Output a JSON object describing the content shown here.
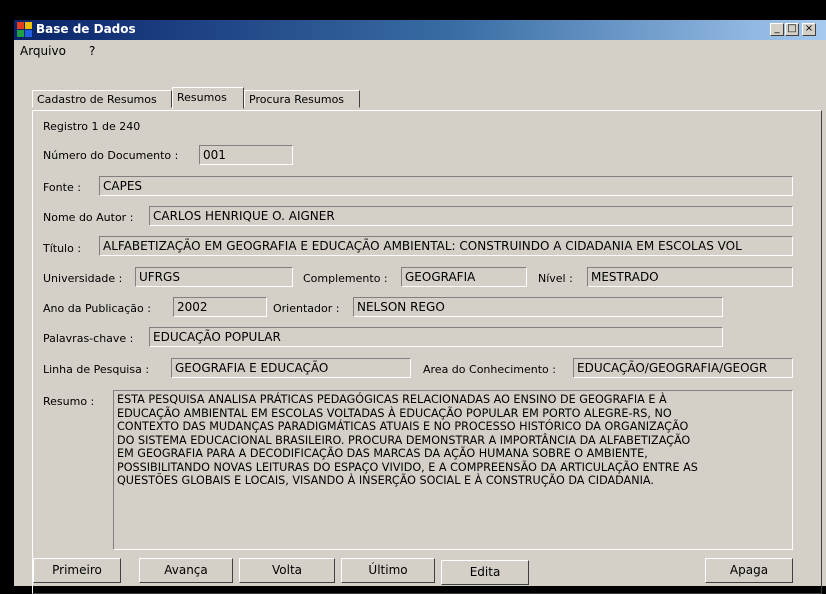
{
  "window": {
    "title": "Base de Dados",
    "minimize": "_",
    "maximize": "□",
    "close": "×"
  },
  "menu": [
    "Arquivo",
    "?"
  ],
  "tabs": [
    "Cadastro de Resumos",
    "Resumos",
    "Procura Resumos"
  ],
  "active_tab": "Resumos",
  "record_status": "Registro 1 de 240",
  "form": {
    "numero": {
      "label": "Número do Documento :",
      "value": "001"
    },
    "fonte": {
      "label": "Fonte :",
      "value": "CAPES"
    },
    "autor": {
      "label": "Nome do Autor :",
      "value": "CARLOS HENRIQUE O. AIGNER"
    },
    "titulo": {
      "label": "Título :",
      "value": "ALFABETIZAÇÃO EM GEOGRAFIA E EDUCAÇÃO AMBIENTAL: CONSTRUINDO A CIDADANIA EM ESCOLAS VOL"
    },
    "universidade": {
      "label": "Universidade :",
      "value": "UFRGS"
    },
    "complemento": {
      "label": "Complemento :",
      "value": "GEOGRAFIA"
    },
    "nivel": {
      "label": "Nível :",
      "value": "MESTRADO"
    },
    "ano": {
      "label": "Ano da Publicação :",
      "value": "2002"
    },
    "orientador": {
      "label": "Orientador :",
      "value": "NELSON REGO"
    },
    "palavras": {
      "label": "Palavras-chave :",
      "value": "EDUCAÇÃO POPULAR"
    },
    "linha": {
      "label": "Linha de Pesquisa :",
      "value": "GEOGRAFIA E EDUCAÇÃO"
    },
    "area": {
      "label": "Area do Conhecimento :",
      "value": "EDUCAÇÃO/GEOGRAFIA/GEOGR"
    },
    "resumo": {
      "label": "Resumo :",
      "lines": [
        "ESTA PESQUISA ANALISA PRÁTICAS PEDAGÓGICAS RELACIONADAS AO ENSINO DE GEOGRAFIA E À",
        "EDUCAÇÃO AMBIENTAL EM ESCOLAS VOLTADAS À EDUCAÇÃO POPULAR EM PORTO ALEGRE-RS, NO",
        "CONTEXTO DAS MUDANÇAS PARADIGMÁTICAS ATUAIS E NO PROCESSO HISTÓRICO DA ORGANIZAÇÃO",
        "DO SISTEMA EDUCACIONAL BRASILEIRO. PROCURA DEMONSTRAR A IMPORTÂNCIA DA ALFABETIZAÇÃO",
        "EM GEOGRAFIA PARA A DECODIFICAÇÃO DAS MARCAS DA AÇÃO HUMANA SOBRE O AMBIENTE,",
        "POSSIBILITANDO NOVAS LEITURAS DO ESPAÇO VIVIDO, E A COMPREENSÃO DA ARTICULAÇÃO ENTRE AS",
        "QUESTÕES GLOBAIS E LOCAIS, VISANDO À INSERÇÃO SOCIAL E À CONSTRUÇÃO DA CIDADANIA."
      ]
    }
  },
  "buttons": {
    "primeiro": "Primeiro",
    "avanca": "Avança",
    "volta": "Volta",
    "ultimo": "Último",
    "edita": "Edita",
    "apaga": "Apaga"
  }
}
